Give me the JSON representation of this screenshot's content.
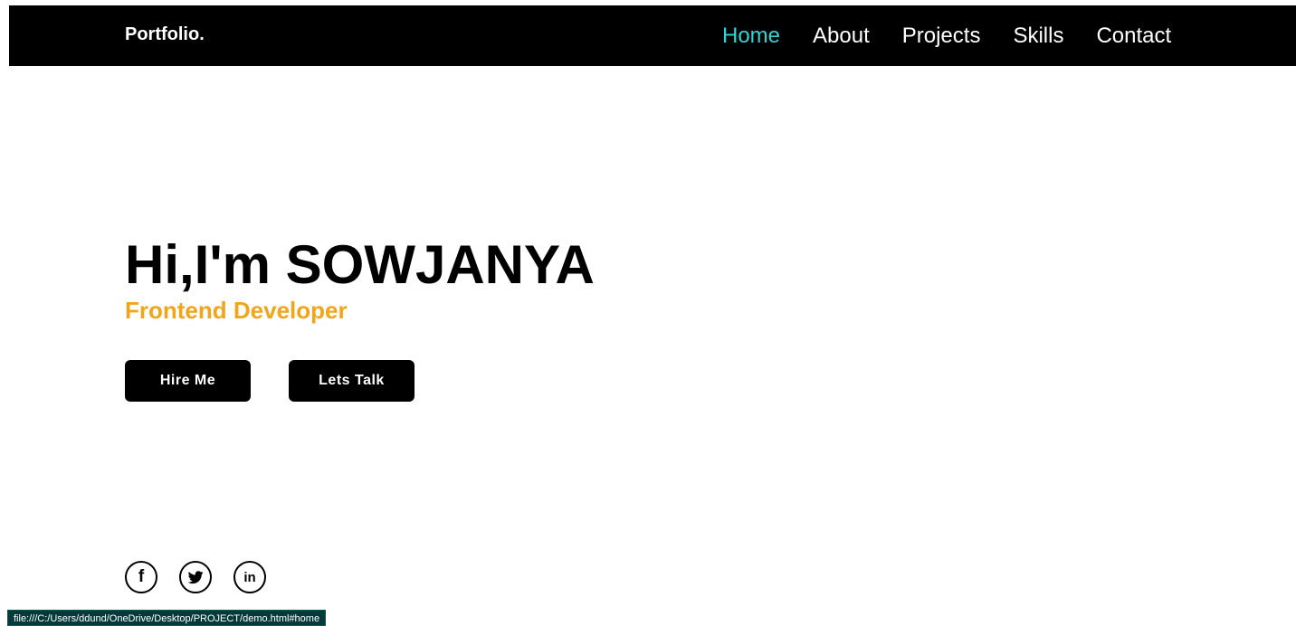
{
  "navbar": {
    "logo": "Portfolio.",
    "links": [
      {
        "label": "Home",
        "active": true
      },
      {
        "label": "About",
        "active": false
      },
      {
        "label": "Projects",
        "active": false
      },
      {
        "label": "Skills",
        "active": false
      },
      {
        "label": "Contact",
        "active": false
      }
    ],
    "active_color": "#2fd4d4"
  },
  "hero": {
    "title": "Hi,I'm SOWJANYA",
    "subtitle": "Frontend Developer",
    "subtitle_color": "#f2a51a",
    "buttons": {
      "hire_label": "Hire Me",
      "talk_label": "Lets Talk"
    }
  },
  "socials": [
    {
      "icon": "facebook-icon"
    },
    {
      "icon": "twitter-icon"
    },
    {
      "icon": "linkedin-icon"
    }
  ],
  "status_bar": {
    "url": "file:///C:/Users/ddund/OneDrive/Desktop/PROJECT/demo.html#home"
  }
}
